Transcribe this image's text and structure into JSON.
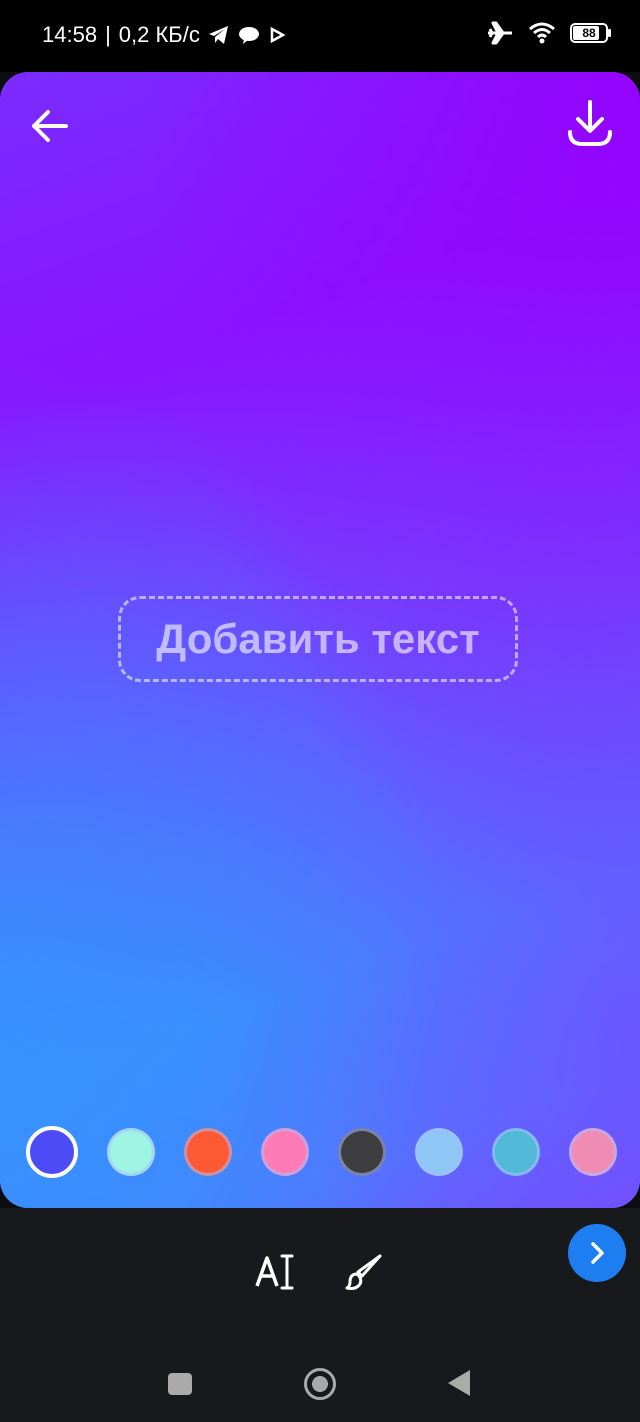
{
  "status_bar": {
    "time": "14:58",
    "separator": "|",
    "speed": "0,2 КБ/с",
    "battery": "88",
    "icons": [
      "telegram-icon",
      "chat-bubble-icon",
      "play-icon",
      "airplane-icon",
      "wifi-icon",
      "battery-icon"
    ]
  },
  "canvas": {
    "placeholder_text": "Добавить текст",
    "gradient_colors": [
      "#8a14ff",
      "#6d4bff",
      "#3f8aff"
    ]
  },
  "swatches": [
    {
      "color": "#4b4cf5",
      "selected": true
    },
    {
      "color": "#9ff5e3",
      "selected": false
    },
    {
      "color": "#ff5a36",
      "selected": false
    },
    {
      "color": "#ff7bb5",
      "selected": false
    },
    {
      "color": "#3e3e40",
      "selected": false
    },
    {
      "color": "#8fc6f5",
      "selected": false
    },
    {
      "color": "#52b8d8",
      "selected": false
    },
    {
      "color": "#f08cb4",
      "selected": false
    }
  ],
  "toolbar": {
    "tools": [
      "text-tool-icon",
      "brush-icon"
    ],
    "next_color": "#1d7ef2"
  },
  "nav": [
    "recents-button",
    "home-button",
    "back-button"
  ]
}
